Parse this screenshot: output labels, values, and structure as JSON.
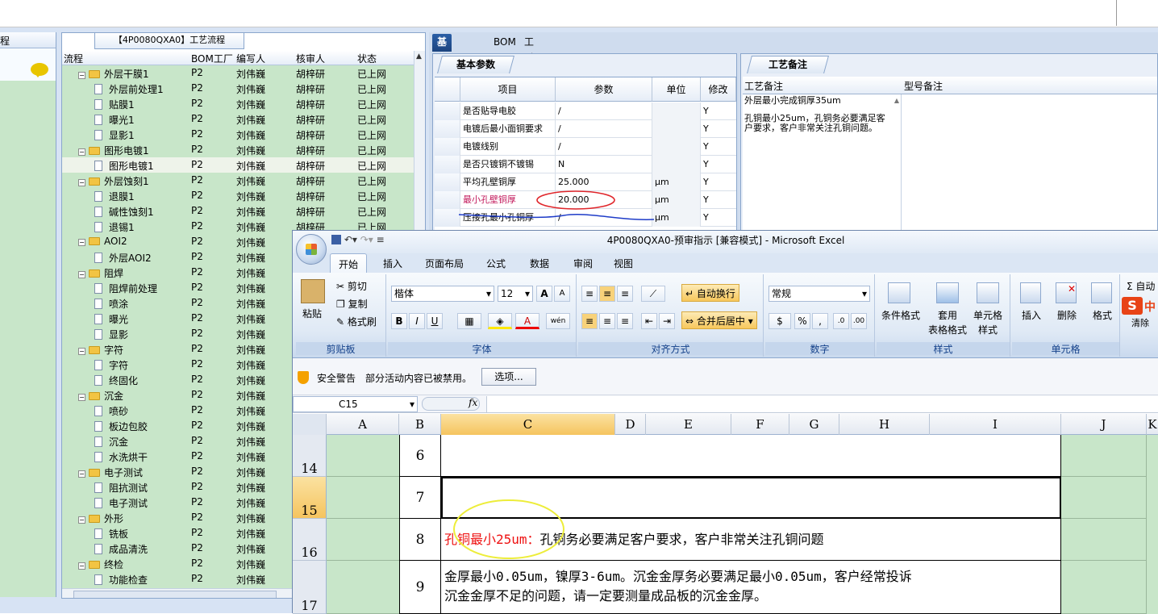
{
  "tree": {
    "title": "【4P0080QXA0】工艺流程",
    "left_label": "程",
    "columns": [
      "流程",
      "BOM工厂",
      "编写人",
      "核审人",
      "状态"
    ],
    "rows": [
      {
        "level": 0,
        "name": "外层干膜1",
        "bom": "P2",
        "writer": "刘伟巍",
        "checker": "胡梓研",
        "status": "已上网"
      },
      {
        "level": 1,
        "name": "外层前处理1",
        "bom": "P2",
        "writer": "刘伟巍",
        "checker": "胡梓研",
        "status": "已上网"
      },
      {
        "level": 1,
        "name": "贴膜1",
        "bom": "P2",
        "writer": "刘伟巍",
        "checker": "胡梓研",
        "status": "已上网"
      },
      {
        "level": 1,
        "name": "曝光1",
        "bom": "P2",
        "writer": "刘伟巍",
        "checker": "胡梓研",
        "status": "已上网"
      },
      {
        "level": 1,
        "name": "显影1",
        "bom": "P2",
        "writer": "刘伟巍",
        "checker": "胡梓研",
        "status": "已上网"
      },
      {
        "level": 0,
        "name": "图形电镀1",
        "bom": "P2",
        "writer": "刘伟巍",
        "checker": "胡梓研",
        "status": "已上网"
      },
      {
        "level": 1,
        "name": "图形电镀1",
        "bom": "P2",
        "writer": "刘伟巍",
        "checker": "胡梓研",
        "status": "已上网",
        "selected": true
      },
      {
        "level": 0,
        "name": "外层蚀刻1",
        "bom": "P2",
        "writer": "刘伟巍",
        "checker": "胡梓研",
        "status": "已上网"
      },
      {
        "level": 1,
        "name": "退膜1",
        "bom": "P2",
        "writer": "刘伟巍",
        "checker": "胡梓研",
        "status": "已上网"
      },
      {
        "level": 1,
        "name": "碱性蚀刻1",
        "bom": "P2",
        "writer": "刘伟巍",
        "checker": "胡梓研",
        "status": "已上网"
      },
      {
        "level": 1,
        "name": "退锡1",
        "bom": "P2",
        "writer": "刘伟巍",
        "checker": "胡梓研",
        "status": "已上网"
      },
      {
        "level": 0,
        "name": "AOI2",
        "bom": "P2",
        "writer": "刘伟巍",
        "checker": "",
        "status": ""
      },
      {
        "level": 1,
        "name": "外层AOI2",
        "bom": "P2",
        "writer": "刘伟巍",
        "checker": "",
        "status": ""
      },
      {
        "level": 0,
        "name": "阻焊",
        "bom": "P2",
        "writer": "刘伟巍",
        "checker": "",
        "status": ""
      },
      {
        "level": 1,
        "name": "阻焊前处理",
        "bom": "P2",
        "writer": "刘伟巍",
        "checker": "",
        "status": ""
      },
      {
        "level": 1,
        "name": "喷涂",
        "bom": "P2",
        "writer": "刘伟巍",
        "checker": "",
        "status": ""
      },
      {
        "level": 1,
        "name": "曝光",
        "bom": "P2",
        "writer": "刘伟巍",
        "checker": "",
        "status": ""
      },
      {
        "level": 1,
        "name": "显影",
        "bom": "P2",
        "writer": "刘伟巍",
        "checker": "",
        "status": ""
      },
      {
        "level": 0,
        "name": "字符",
        "bom": "P2",
        "writer": "刘伟巍",
        "checker": "",
        "status": ""
      },
      {
        "level": 1,
        "name": "字符",
        "bom": "P2",
        "writer": "刘伟巍",
        "checker": "",
        "status": ""
      },
      {
        "level": 1,
        "name": "终固化",
        "bom": "P2",
        "writer": "刘伟巍",
        "checker": "",
        "status": ""
      },
      {
        "level": 0,
        "name": "沉金",
        "bom": "P2",
        "writer": "刘伟巍",
        "checker": "",
        "status": ""
      },
      {
        "level": 1,
        "name": "喷砂",
        "bom": "P2",
        "writer": "刘伟巍",
        "checker": "",
        "status": ""
      },
      {
        "level": 1,
        "name": "板边包胶",
        "bom": "P2",
        "writer": "刘伟巍",
        "checker": "",
        "status": ""
      },
      {
        "level": 1,
        "name": "沉金",
        "bom": "P2",
        "writer": "刘伟巍",
        "checker": "",
        "status": ""
      },
      {
        "level": 1,
        "name": "水洗烘干",
        "bom": "P2",
        "writer": "刘伟巍",
        "checker": "",
        "status": ""
      },
      {
        "level": 0,
        "name": "电子测试",
        "bom": "P2",
        "writer": "刘伟巍",
        "checker": "",
        "status": ""
      },
      {
        "level": 1,
        "name": "阻抗测试",
        "bom": "P2",
        "writer": "刘伟巍",
        "checker": "",
        "status": ""
      },
      {
        "level": 1,
        "name": "电子测试",
        "bom": "P2",
        "writer": "刘伟巍",
        "checker": "",
        "status": ""
      },
      {
        "level": 0,
        "name": "外形",
        "bom": "P2",
        "writer": "刘伟巍",
        "checker": "",
        "status": ""
      },
      {
        "level": 1,
        "name": "铣板",
        "bom": "P2",
        "writer": "刘伟巍",
        "checker": "",
        "status": ""
      },
      {
        "level": 1,
        "name": "成品清洗",
        "bom": "P2",
        "writer": "刘伟巍",
        "checker": "",
        "status": ""
      },
      {
        "level": 0,
        "name": "终检",
        "bom": "P2",
        "writer": "刘伟巍",
        "checker": "",
        "status": ""
      },
      {
        "level": 1,
        "name": "功能检查",
        "bom": "P2",
        "writer": "刘伟巍",
        "checker": "",
        "status": ""
      }
    ]
  },
  "info": {
    "tabs": [
      "基本信息",
      "BOM",
      "工时"
    ],
    "basic_tab": "基本参数",
    "columns": [
      "项目",
      "参数",
      "单位",
      "修改"
    ],
    "rows": [
      {
        "item": "是否贴导电胶",
        "param": "/",
        "unit": "",
        "mod": "Y"
      },
      {
        "item": "电镀后最小面铜要求",
        "param": "/",
        "unit": "",
        "mod": "Y"
      },
      {
        "item": "电镀线别",
        "param": "/",
        "unit": "",
        "mod": "Y"
      },
      {
        "item": "是否只镀铜不镀锡",
        "param": "N",
        "unit": "",
        "mod": "Y"
      },
      {
        "item": "平均孔壁铜厚",
        "param": "25.000",
        "unit": "μm",
        "mod": "Y"
      },
      {
        "item": "最小孔壁铜厚",
        "param": "20.000",
        "unit": "μm",
        "mod": "Y",
        "highlight": true
      },
      {
        "item": "压接孔最小孔铜厚",
        "param": "/",
        "unit": "μm",
        "mod": "Y"
      }
    ],
    "note_tab": "工艺备注",
    "note_columns": [
      "工艺备注",
      "型号备注"
    ],
    "note_text_1": "外层最小完成铜厚35um",
    "note_text_2": "孔铜最小25um，孔铜务必要满足客户要求，客户非常关注孔铜问题。"
  },
  "excel": {
    "title": "4P0080QXA0-预审指示 [兼容模式] - Microsoft Excel",
    "tabs": [
      "开始",
      "插入",
      "页面布局",
      "公式",
      "数据",
      "审阅",
      "视图"
    ],
    "clipboard": {
      "paste": "粘贴",
      "cut": "剪切",
      "copy": "复制",
      "format_painter": "格式刷",
      "label": "剪贴板"
    },
    "font": {
      "name": "楷体",
      "size": "12",
      "label": "字体",
      "bold": "B",
      "italic": "I",
      "underline": "U",
      "grow": "A",
      "shrink": "A",
      "color": "A",
      "phonetic": "wén"
    },
    "align": {
      "wrap": "自动换行",
      "merge": "合并后居中",
      "label": "对齐方式"
    },
    "number": {
      "format": "常规",
      "label": "数字",
      "percent": "%",
      "comma": ",",
      "inc": ".0",
      "dec": ".00"
    },
    "styles": {
      "cond": "条件格式",
      "table": "套用",
      "table2": "表格格式",
      "cell": "单元格",
      "cell2": "样式",
      "label": "样式"
    },
    "cells": {
      "insert": "插入",
      "delete": "删除",
      "format": "格式",
      "label": "单元格"
    },
    "edit": {
      "sum": "Σ 自动",
      "clear": "清除"
    },
    "security": {
      "title": "安全警告",
      "message": "部分活动内容已被禁用。",
      "options": "选项..."
    },
    "name_box": "C15",
    "fx": "fx",
    "columns": [
      "A",
      "B",
      "C",
      "D",
      "E",
      "F",
      "G",
      "H",
      "I",
      "J",
      "K"
    ],
    "rows": [
      {
        "num": "14",
        "b": "6",
        "c": "",
        "c_red": ""
      },
      {
        "num": "15",
        "b": "7",
        "c": "",
        "c_red": ""
      },
      {
        "num": "16",
        "b": "8",
        "c_red": "孔铜最小25um：",
        "c": "孔铜务必要满足客户要求，客户非常关注孔铜问题"
      },
      {
        "num": "17",
        "b": "9",
        "c_red": "",
        "c": "金厚最小0.05um，镍厚3-6um。沉金金厚务必要满足最小0.05um，客户经常投诉\n沉金金厚不足的问题，请一定要测量成品板的沉金金厚。"
      }
    ],
    "ime": "中"
  },
  "colors": {
    "accent": "#1c447f",
    "green": "#c8e6c9",
    "highlight": "#f5c45f"
  }
}
